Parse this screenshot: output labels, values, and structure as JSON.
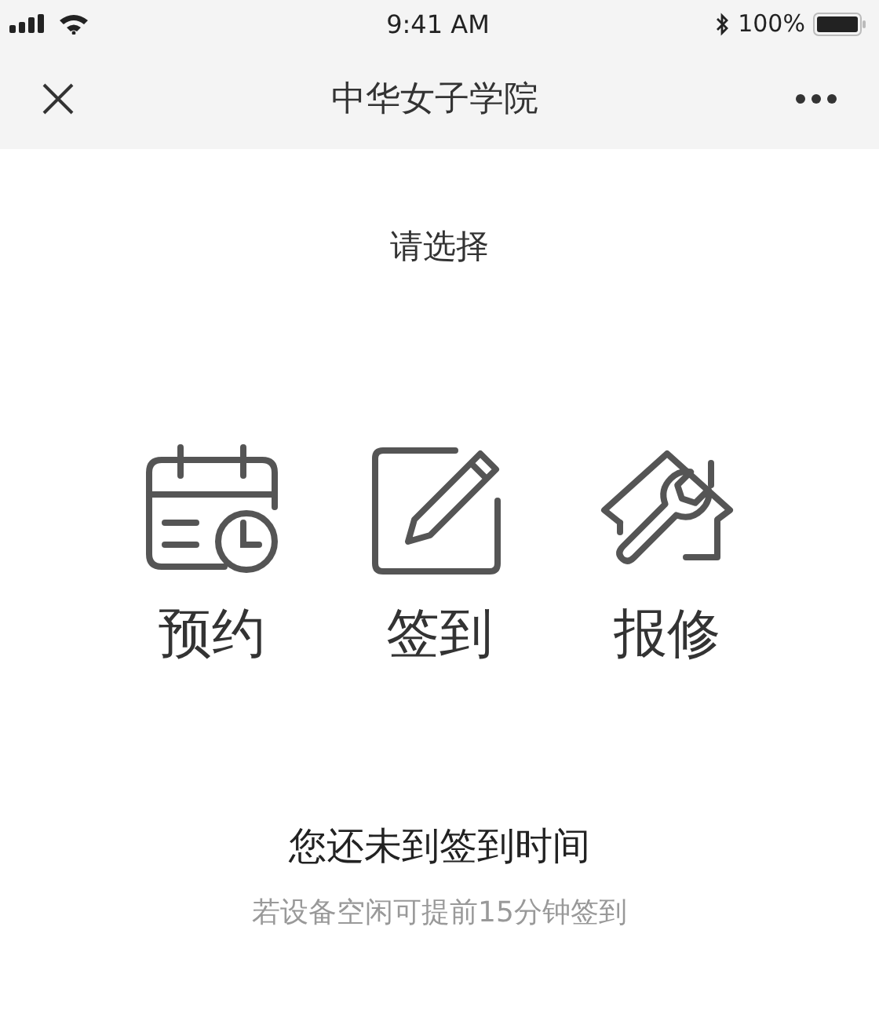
{
  "status_bar": {
    "time": "9:41 AM",
    "battery": "100%"
  },
  "nav": {
    "title": "中华女子学院"
  },
  "prompt": "请选择",
  "actions": [
    {
      "label": "预约"
    },
    {
      "label": "签到"
    },
    {
      "label": "报修"
    }
  ],
  "message": {
    "title": "您还未到签到时间",
    "hint": "若设备空闲可提前15分钟签到"
  }
}
